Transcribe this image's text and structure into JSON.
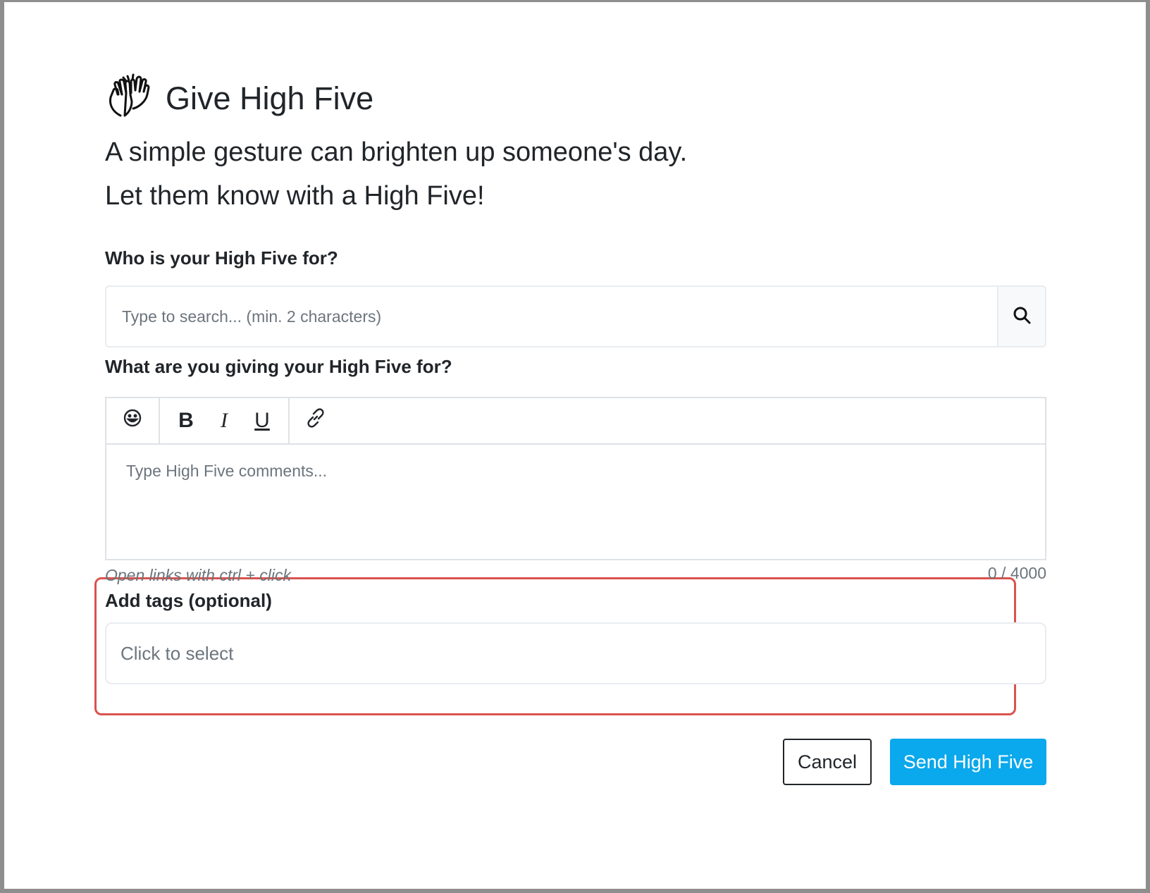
{
  "dialog": {
    "title": "Give High Five",
    "subtitle_line1": "A simple gesture can brighten up someone's day.",
    "subtitle_line2": "Let them know with a High Five!",
    "icon": "clapping-hands-icon"
  },
  "recipient": {
    "label": "Who is your High Five for?",
    "placeholder": "Type to search... (min. 2 characters)",
    "search_icon": "search-icon"
  },
  "comment": {
    "label": "What are you giving your High Five for?",
    "toolbar": {
      "emoji_icon": "emoji-icon",
      "bold_label": "B",
      "italic_label": "I",
      "underline_label": "U",
      "link_icon": "link-icon"
    },
    "placeholder": "Type High Five comments...",
    "hint": "Open links with ctrl + click",
    "counter": "0 / 4000"
  },
  "tags": {
    "label": "Add tags (optional)",
    "placeholder": "Click to select",
    "highlight_color": "#d9534f"
  },
  "actions": {
    "cancel_label": "Cancel",
    "send_label": "Send High Five",
    "send_color": "#0aa8ec"
  }
}
